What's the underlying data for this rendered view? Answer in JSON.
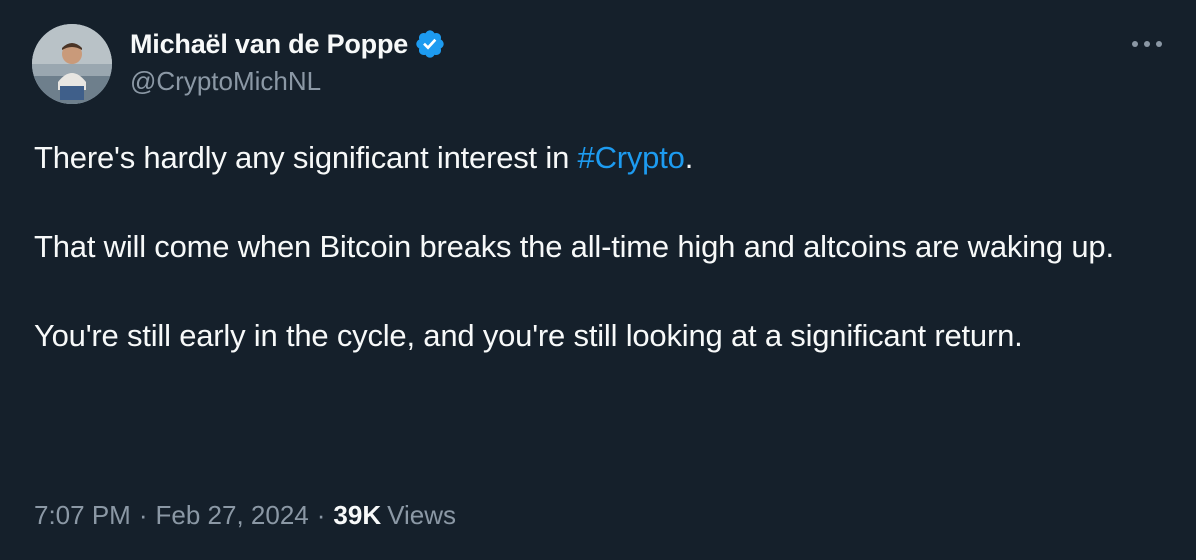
{
  "author": {
    "display_name": "Michaël van de Poppe",
    "handle": "@CryptoMichNL",
    "verified": true,
    "verified_color": "#1d9bf0",
    "avatar_icon": "profile-photo"
  },
  "tweet": {
    "paragraphs": [
      {
        "before": "There's hardly any significant interest in ",
        "hashtag": "#Crypto",
        "after": "."
      },
      {
        "text": "That will come when Bitcoin breaks the all-time high and altcoins are waking up."
      },
      {
        "text": "You're still early in the cycle, and you're still looking at a significant return."
      }
    ],
    "hashtag_color": "#1d9bf0"
  },
  "meta": {
    "time": "7:07 PM",
    "separator": "·",
    "date": "Feb 27, 2024",
    "views_count": "39K",
    "views_label": "Views"
  },
  "more_icon": "more-horizontal-icon"
}
